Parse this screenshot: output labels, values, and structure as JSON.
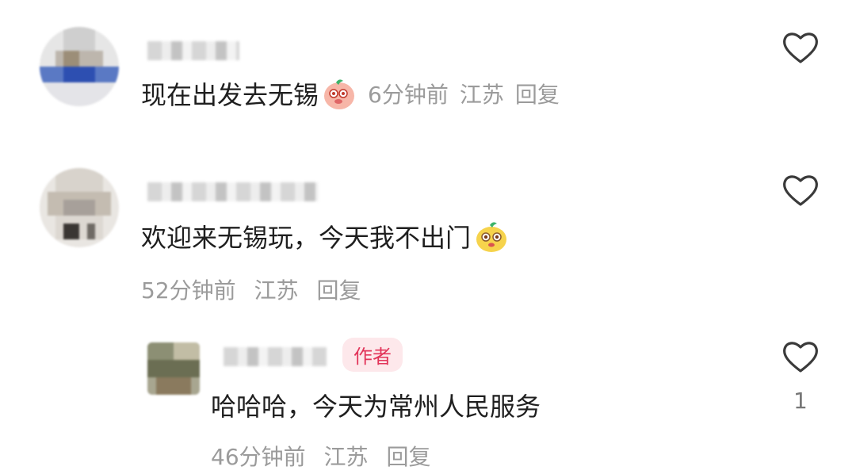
{
  "comments": [
    {
      "text": "现在出发去无锡",
      "emoji": "peach-face-emoji",
      "time": "6分钟前",
      "location": "江苏",
      "reply_label": "回复"
    },
    {
      "text": "欢迎来无锡玩，今天我不出门",
      "emoji": "yellow-face-emoji",
      "time": "52分钟前",
      "location": "江苏",
      "reply_label": "回复"
    }
  ],
  "reply": {
    "author_badge": "作者",
    "text": "哈哈哈，今天为常州人民服务",
    "time": "46分钟前",
    "location": "江苏",
    "reply_label": "回复",
    "like_count": "1"
  },
  "colors": {
    "text": "#1f1f1f",
    "meta": "#9b9b9b",
    "badge_bg": "#fde8eb",
    "badge_fg": "#e2355a"
  }
}
